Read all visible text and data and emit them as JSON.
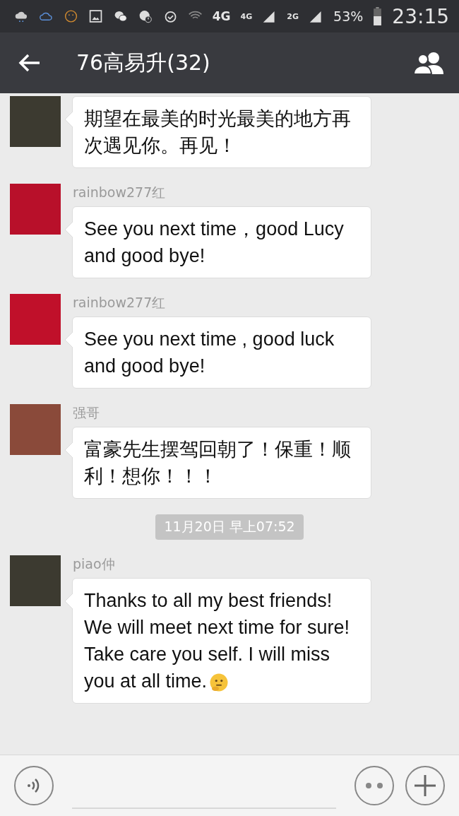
{
  "status_bar": {
    "network": "4G",
    "signal_1": "4G",
    "signal_2": "2G",
    "battery": "53%",
    "time": "23:15"
  },
  "header": {
    "title": "76高易升(32)"
  },
  "chat": [
    {
      "kind": "message",
      "text": "期望在最美的时光最美的地方再次遇见你。再见！"
    },
    {
      "kind": "message",
      "sender": "rainbow277红",
      "text": "See you next time，good Lucy and good bye!"
    },
    {
      "kind": "message",
      "sender": "rainbow277红",
      "text": "See you next time , good luck and good bye!"
    },
    {
      "kind": "message",
      "sender": "强哥",
      "text": "富豪先生摆驾回朝了！保重！顺利！想你！！！"
    },
    {
      "kind": "timestamp",
      "text": "11月20日 早上07:52"
    },
    {
      "kind": "message",
      "sender": "piao仲",
      "text": "Thanks to all my best friends! We will meet next time for sure! Take care you self. I will miss you at all time.",
      "emoji": true
    }
  ]
}
